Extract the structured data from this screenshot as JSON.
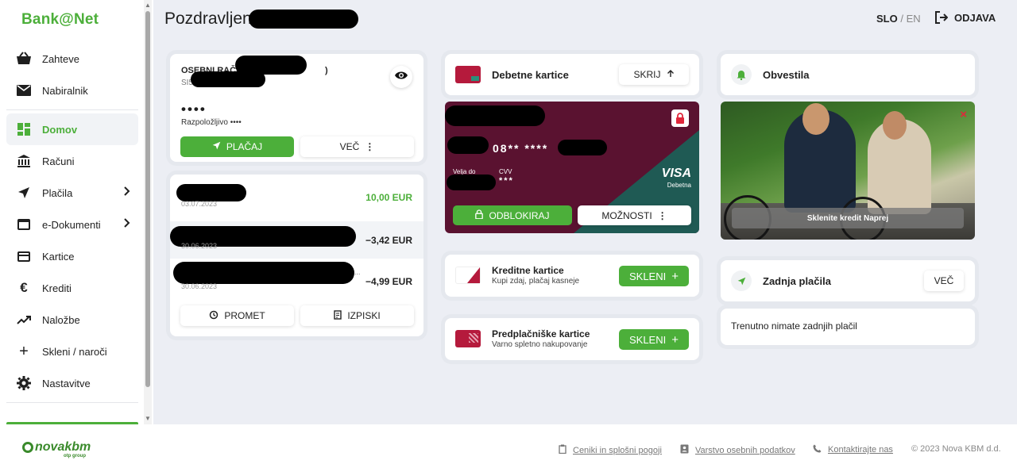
{
  "sidebar": {
    "logo": "Bank@Net",
    "items": [
      {
        "label": "Zahteve",
        "icon": "basket-icon"
      },
      {
        "label": "Nabiralnik",
        "icon": "mail-icon"
      },
      {
        "label": "Domov",
        "icon": "dashboard-icon",
        "active": true
      },
      {
        "label": "Računi",
        "icon": "bank-icon"
      },
      {
        "label": "Plačila",
        "icon": "send-icon",
        "has_submenu": true
      },
      {
        "label": "e-Dokumenti",
        "icon": "window-icon",
        "has_submenu": true
      },
      {
        "label": "Kartice",
        "icon": "card-icon"
      },
      {
        "label": "Krediti",
        "icon": "euro-icon"
      },
      {
        "label": "Naložbe",
        "icon": "trending-up-icon"
      },
      {
        "label": "Skleni / naroči",
        "icon": "plus-icon"
      },
      {
        "label": "Nastavitve",
        "icon": "gear-icon"
      }
    ]
  },
  "header": {
    "greeting": "Pozdravljeni,",
    "lang_active": "SLO",
    "lang_sep": " / ",
    "lang_other": "EN",
    "logout_label": "ODJAVA"
  },
  "account": {
    "title": "OSEBNI RAČUN",
    "title_suffix": ")",
    "subtitle": "SI5",
    "balance_mask": "••••",
    "available_label": "Razpoložljivo ••••",
    "pay_label": "PLAČAJ",
    "more_label": "VEČ",
    "transactions": [
      {
        "date": "03.07.2023",
        "amount": "10,00 EUR",
        "positive": true
      },
      {
        "date": "30.06.2023",
        "amount": "−3,42 EUR",
        "positive": false
      },
      {
        "date": "30.06.2023",
        "amount": "−4,99 EUR",
        "positive": false,
        "desc_suffix": "..."
      }
    ],
    "turnover_label": "PROMET",
    "statements_label": "IZPISKI"
  },
  "debit": {
    "title": "Debetne kartice",
    "hide_label": "SKRIJ",
    "card_number": "08** ****",
    "valid_label": "Velja do",
    "cvv_label": "CVV",
    "cvv_value": "***",
    "brand": "VISA",
    "brand_sub": "Debetna",
    "unblock_label": "ODBLOKIRAJ",
    "options_label": "MOŽNOSTI"
  },
  "credit": {
    "title": "Kreditne kartice",
    "subtitle": "Kupi zdaj, plačaj kasneje",
    "button": "SKLENI"
  },
  "prepaid": {
    "title": "Predplačniške kartice",
    "subtitle": "Varno spletno nakupovanje",
    "button": "SKLENI"
  },
  "notifications": {
    "title": "Obvestila",
    "banner": "Sklenite kredit Naprej",
    "close_icon": "×"
  },
  "last_payments": {
    "title": "Zadnja plačila",
    "more_label": "VEČ",
    "empty_text": "Trenutno nimate zadnjih plačil"
  },
  "footer": {
    "logo": "novakbm",
    "logo_sub": "otp group",
    "links": [
      "Ceniki in splošni pogoji",
      "Varstvo osebnih podatkov",
      "Kontaktirajte nas"
    ],
    "copyright": "© 2023 Nova KBM d.d."
  },
  "colors": {
    "accent": "#4caf3a",
    "card_dark": "#5a1230",
    "card_teal": "#1f5a54",
    "close_red": "#e0273b",
    "background": "#eceef4"
  }
}
